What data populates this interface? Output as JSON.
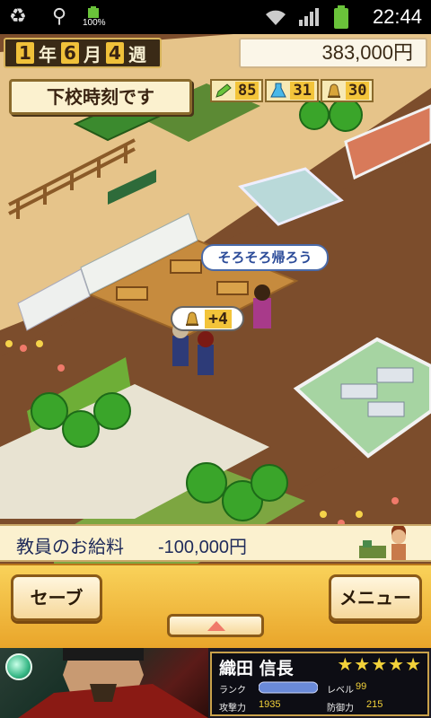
{
  "status_bar": {
    "battery_label": "100%",
    "time": "22:44",
    "icons": [
      "recycle-icon",
      "usb-icon",
      "battery-charging-icon",
      "wifi-icon",
      "signal-icon",
      "battery-icon"
    ]
  },
  "hud": {
    "date": {
      "year_num": "1",
      "year_unit": "年",
      "month_num": "6",
      "month_unit": "月",
      "week_num": "4",
      "week_unit": "週"
    },
    "money": "383,000円",
    "notice": "下校時刻です",
    "stats": [
      {
        "icon": "pencil-icon",
        "value": "85"
      },
      {
        "icon": "flask-icon",
        "value": "31"
      },
      {
        "icon": "bell-icon",
        "value": "30"
      }
    ]
  },
  "scene": {
    "speech_bubble": "そろそろ帰ろう",
    "bonus_value": "+4",
    "bonus_icon": "bell-icon"
  },
  "salary_bar": {
    "label": "教員のお給料",
    "amount": "-100,000円"
  },
  "controls": {
    "save_label": "セーブ",
    "menu_label": "メニュー",
    "expand_icon": "triangle-up-icon"
  },
  "banner": {
    "name": "織田 信長",
    "stars": "★★★★★",
    "rank_label": "ランク",
    "level_label": "レベル",
    "level_value": "99",
    "attack_label": "攻撃力",
    "attack_value": "1935",
    "defense_label": "防御力",
    "defense_value": "215"
  },
  "colors": {
    "floor_wood": "#7c4d2c",
    "panel_cream": "#fbf1cf",
    "control_bar": "#f2bb3a",
    "accent_gold": "#f3c43a"
  }
}
